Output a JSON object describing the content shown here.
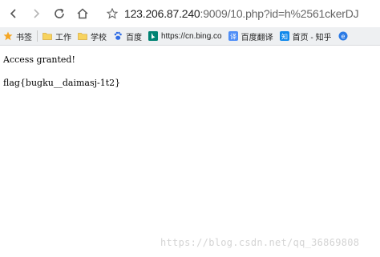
{
  "navbar": {
    "url_host": "123.206.87.240",
    "url_rest": ":9009/10.php?id=h%2561ckerDJ"
  },
  "bookmarks": [
    {
      "label": "书签",
      "icon": "star-icon",
      "color": "#f5a623"
    },
    {
      "label": "工作",
      "icon": "folder-icon",
      "color": "#f2c14e"
    },
    {
      "label": "学校",
      "icon": "folder-icon",
      "color": "#f2c14e"
    },
    {
      "label": "百度",
      "icon": "baidu-paw-icon",
      "color": "#2f6ce5"
    },
    {
      "label": "https://cn.bing.co",
      "icon": "bing-icon",
      "color": "#008373"
    },
    {
      "label": "百度翻译",
      "icon": "baidu-translate-icon",
      "color": "#4e8ef7"
    },
    {
      "label": "首页 - 知乎",
      "icon": "zhihu-icon",
      "color": "#0f88eb"
    },
    {
      "label": "",
      "icon": "e-icon",
      "color": "#2c7be5"
    }
  ],
  "page": {
    "line1": "Access granted!",
    "line2": "flag{bugku__daimasj-1t2}"
  },
  "watermark": "https://blog.csdn.net/qq_36869808"
}
